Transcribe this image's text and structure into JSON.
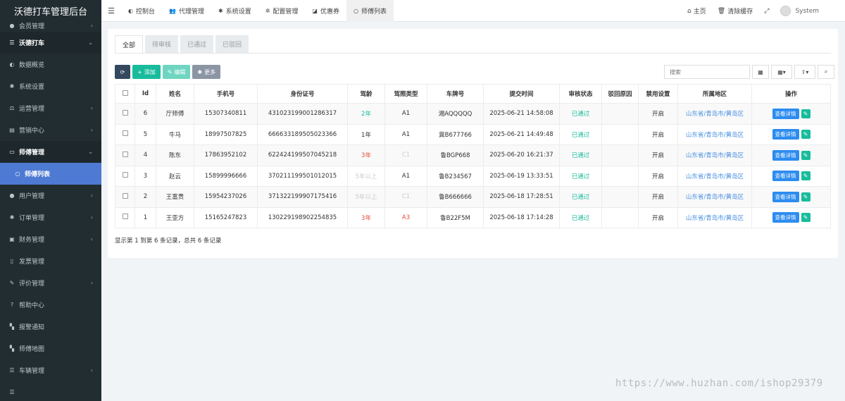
{
  "app_title": "沃德打车管理后台",
  "sidebar": {
    "items": [
      {
        "icon": "user-circle-icon",
        "glyph": "●",
        "label": "会员管理",
        "chevron": "‹",
        "style": "first"
      },
      {
        "icon": "list-icon",
        "glyph": "☰",
        "label": "沃德打车",
        "chevron": "⌄",
        "style": "header-open"
      },
      {
        "icon": "dashboard-icon",
        "glyph": "◐",
        "label": "数据概览",
        "chevron": "",
        "style": ""
      },
      {
        "icon": "gear-icon",
        "glyph": "✱",
        "label": "系统设置",
        "chevron": "",
        "style": ""
      },
      {
        "icon": "balance-icon",
        "glyph": "⚖",
        "label": "运营管理",
        "chevron": "‹",
        "style": ""
      },
      {
        "icon": "calendar-icon",
        "glyph": "▤",
        "label": "营销中心",
        "chevron": "‹",
        "style": ""
      },
      {
        "icon": "id-card-icon",
        "glyph": "▭",
        "label": "师傅管理",
        "chevron": "⌄",
        "style": "header-open"
      },
      {
        "icon": "circle-icon",
        "glyph": "○",
        "label": "师傅列表",
        "chevron": "",
        "style": "sub-active"
      },
      {
        "icon": "user-icon",
        "glyph": "●",
        "label": "用户管理",
        "chevron": "‹",
        "style": ""
      },
      {
        "icon": "cog-icon",
        "glyph": "✺",
        "label": "订单管理",
        "chevron": "‹",
        "style": ""
      },
      {
        "icon": "money-icon",
        "glyph": "▣",
        "label": "财务管理",
        "chevron": "‹",
        "style": ""
      },
      {
        "icon": "file-icon",
        "glyph": "▯",
        "label": "发票管理",
        "chevron": "",
        "style": ""
      },
      {
        "icon": "edit-icon",
        "glyph": "✎",
        "label": "评价管理",
        "chevron": "‹",
        "style": ""
      },
      {
        "icon": "question-icon",
        "glyph": "?",
        "label": "帮助中心",
        "chevron": "",
        "style": ""
      },
      {
        "icon": "map-icon",
        "glyph": "▚",
        "label": "报警通知",
        "chevron": "",
        "style": ""
      },
      {
        "icon": "map-icon",
        "glyph": "▚",
        "label": "师傅地图",
        "chevron": "",
        "style": ""
      },
      {
        "icon": "list-icon",
        "glyph": "☰",
        "label": "车辆管理",
        "chevron": "‹",
        "style": ""
      },
      {
        "icon": "list-icon",
        "glyph": "☰",
        "label": "",
        "chevron": "",
        "style": ""
      }
    ]
  },
  "topbar": {
    "tabs": [
      {
        "icon": "dashboard-icon",
        "glyph": "◐",
        "label": "控制台",
        "active": false
      },
      {
        "icon": "users-icon",
        "glyph": "👥",
        "label": "代理管理",
        "active": false
      },
      {
        "icon": "gear-icon",
        "glyph": "✱",
        "label": "系统设置",
        "active": false
      },
      {
        "icon": "gears-icon",
        "glyph": "✲",
        "label": "配置管理",
        "active": false
      },
      {
        "icon": "ticket-icon",
        "glyph": "◪",
        "label": "优惠券",
        "active": false
      },
      {
        "icon": "circle-icon",
        "glyph": "○",
        "label": "师傅列表",
        "active": true
      }
    ],
    "right": {
      "home": "主页",
      "clear_cache": "清除缓存",
      "user": "System"
    }
  },
  "status_tabs": [
    "全部",
    "待审核",
    "已通过",
    "已驳回"
  ],
  "toolbar": {
    "add": "添加",
    "edit": "编辑",
    "more": "更多",
    "search_placeholder": "搜索"
  },
  "table": {
    "columns": [
      "",
      "Id",
      "姓名",
      "手机号",
      "身份证号",
      "驾龄",
      "驾照类型",
      "车牌号",
      "提交时间",
      "审核状态",
      "驳回原因",
      "禁用设置",
      "所属地区",
      "操作"
    ],
    "rows": [
      {
        "id": "6",
        "name": "厅师傅",
        "phone": "15307340811",
        "id_card": "431023199001286317",
        "driving_age": "2年",
        "age_color": "green",
        "license": "A1",
        "license_color": "dark",
        "plate": "湘AQQQQQ",
        "submit_time": "2025-06-21 14:58:08",
        "status": "已通过",
        "reject": "",
        "disable": "开启",
        "region": "山东省/青岛市/黄岛区"
      },
      {
        "id": "5",
        "name": "牛马",
        "phone": "18997507825",
        "id_card": "666633189505023366",
        "driving_age": "1年",
        "age_color": "dark",
        "license": "A1",
        "license_color": "dark",
        "plate": "冀B677766",
        "submit_time": "2025-06-21 14:49:48",
        "status": "已通过",
        "reject": "",
        "disable": "开启",
        "region": "山东省/青岛市/黄岛区"
      },
      {
        "id": "4",
        "name": "陈东",
        "phone": "17863952102",
        "id_card": "622424199507045218",
        "driving_age": "3年",
        "age_color": "red",
        "license": "C1",
        "license_color": "muted",
        "plate": "鲁BGP668",
        "submit_time": "2025-06-20 16:21:37",
        "status": "已通过",
        "reject": "",
        "disable": "开启",
        "region": "山东省/青岛市/黄岛区"
      },
      {
        "id": "3",
        "name": "赵云",
        "phone": "15899996666",
        "id_card": "370211199501012015",
        "driving_age": "5年以上",
        "age_color": "muted",
        "license": "A1",
        "license_color": "dark",
        "plate": "鲁B234567",
        "submit_time": "2025-06-19 13:33:51",
        "status": "已通过",
        "reject": "",
        "disable": "开启",
        "region": "山东省/青岛市/黄岛区"
      },
      {
        "id": "2",
        "name": "王富贵",
        "phone": "15954237026",
        "id_card": "371322199907175416",
        "driving_age": "5年以上",
        "age_color": "muted",
        "license": "C1",
        "license_color": "muted",
        "plate": "鲁B666666",
        "submit_time": "2025-06-18 17:28:51",
        "status": "已通过",
        "reject": "",
        "disable": "开启",
        "region": "山东省/青岛市/黄岛区"
      },
      {
        "id": "1",
        "name": "王亚方",
        "phone": "15165247823",
        "id_card": "130229198902254835",
        "driving_age": "3年",
        "age_color": "red",
        "license": "A3",
        "license_color": "red",
        "plate": "鲁B22F5M",
        "submit_time": "2025-06-18 17:14:28",
        "status": "已通过",
        "reject": "",
        "disable": "开启",
        "region": "山东省/青岛市/黄岛区"
      }
    ],
    "view_label": "查看详情"
  },
  "footer_info": "显示第 1 到第 6 条记录，总共 6 条记录",
  "watermark": "https://www.huzhan.com/ishop29379"
}
